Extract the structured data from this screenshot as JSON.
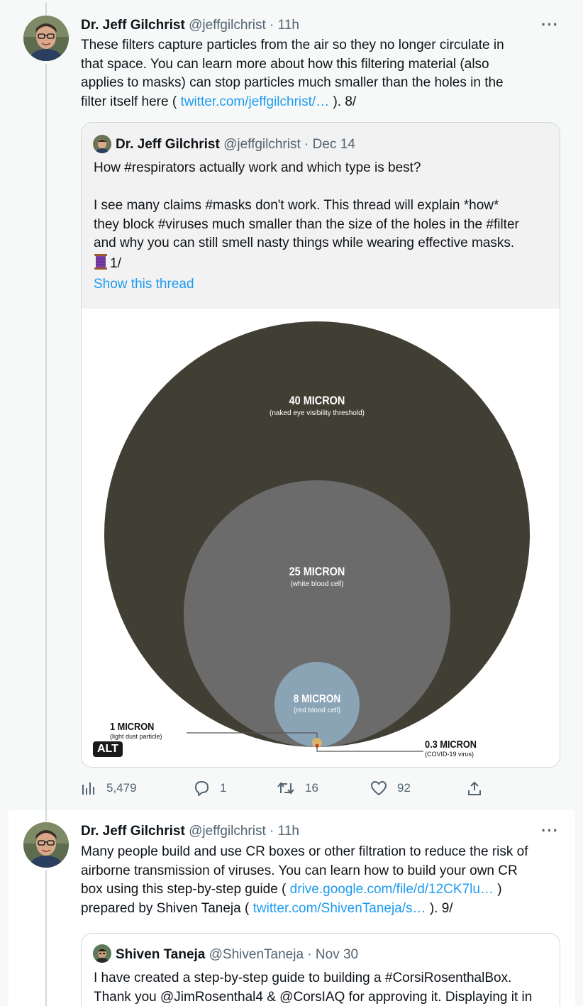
{
  "tweets": [
    {
      "author_name": "Dr. Jeff Gilchrist",
      "handle": "@jeffgilchrist",
      "dot": "·",
      "time": "11h",
      "more": "···",
      "lines": [
        {
          "text": "These filters capture particles from the air so they no longer circulate in"
        },
        {
          "text": "that space. You can learn more about how this filtering material (also"
        },
        {
          "text": "applies to masks) can stop particles much smaller than the holes in the"
        },
        {
          "pre": "filter itself here ( ",
          "link": "twitter.com/jeffgilchrist/…",
          "post": " ). 8/"
        }
      ],
      "quote": {
        "author_name": "Dr. Jeff Gilchrist",
        "handle": "@jeffgilchrist",
        "dot": "·",
        "time": "Dec 14",
        "lines": [
          "How #respirators actually work and which type is best?",
          "",
          "I see many claims #masks don't work. This thread will explain *how*",
          "they block #viruses much smaller than the size of the holes in the #filter",
          "and why you can still smell nasty things while wearing effective masks.",
          "1/"
        ],
        "show_thread": "Show this thread",
        "image": {
          "alt_badge": "ALT",
          "bubbles": [
            {
              "title": "40 MICRON",
              "subtitle": "(naked eye visibility threshold)"
            },
            {
              "title": "25 MICRON",
              "subtitle": "(white blood cell)"
            },
            {
              "title": "8 MICRON",
              "subtitle": "(red blood cell)"
            },
            {
              "title": "1 MICRON",
              "subtitle": "(light dust particle)"
            },
            {
              "title": "0.3 MICRON",
              "subtitle": "(COVID-19 virus)"
            }
          ],
          "colors": {
            "c40": "#413f34",
            "c25": "#6b6b6b",
            "c8": "#8aa3b5",
            "c1": "#d7b46a",
            "c03": "#c0392b"
          }
        }
      },
      "actions": {
        "views": "5,479",
        "replies": "1",
        "retweets": "16",
        "likes": "92"
      }
    },
    {
      "author_name": "Dr. Jeff Gilchrist",
      "handle": "@jeffgilchrist",
      "dot": "·",
      "time": "11h",
      "more": "···",
      "lines": [
        {
          "text": "Many people build and use CR boxes or other filtration to reduce the risk of"
        },
        {
          "text": "airborne transmission of viruses. You can learn how to build your own CR"
        },
        {
          "pre": "box using this step-by-step guide ( ",
          "link": "drive.google.com/file/d/12CK7lu…",
          "post": " )"
        },
        {
          "pre": "prepared by Shiven Taneja ( ",
          "link": "twitter.com/ShivenTaneja/s…",
          "post": " ). 9/"
        }
      ],
      "quote": {
        "author_name": "Shiven Taneja",
        "handle": "@ShivenTaneja",
        "dot": "·",
        "time": "Nov 30",
        "lines": [
          "I have created a step-by-step guide to building a #CorsiRosenthalBox.",
          "Thank you @JimRosenthal4 & @CorsIAQ for approving it. Displaying it in"
        ]
      }
    }
  ]
}
